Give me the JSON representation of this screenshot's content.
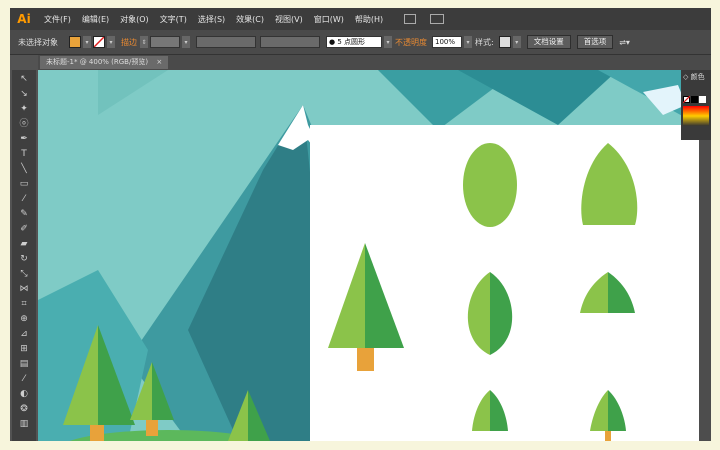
{
  "app": {
    "logo": "Ai"
  },
  "menu": [
    "文件(F)",
    "编辑(E)",
    "对象(O)",
    "文字(T)",
    "选择(S)",
    "效果(C)",
    "视图(V)",
    "窗口(W)",
    "帮助(H)"
  ],
  "control_bar": {
    "selection_label": "未选择对象",
    "stroke_label": "描边",
    "brush_label": "5 点圆形",
    "opacity_label": "不透明度",
    "opacity_value": "100%",
    "style_label": "样式:",
    "doc_setup_button": "文档设置",
    "prefs_button": "首选项",
    "fill_color": "#e8a23a"
  },
  "document_tab": {
    "title": "未标题-1* @ 400% (RGB/预览)",
    "close": "×"
  },
  "color_panel": {
    "title": "◇ 颜色"
  },
  "colors": {
    "bg_teal": "#7fcbc6",
    "mountain_dark": "#2f7e86",
    "mountain_mid": "#3e9aa0",
    "snow": "#ffffff",
    "leaf_light": "#8bc34a",
    "leaf_dark": "#3fa14a",
    "trunk": "#e8a23a"
  }
}
